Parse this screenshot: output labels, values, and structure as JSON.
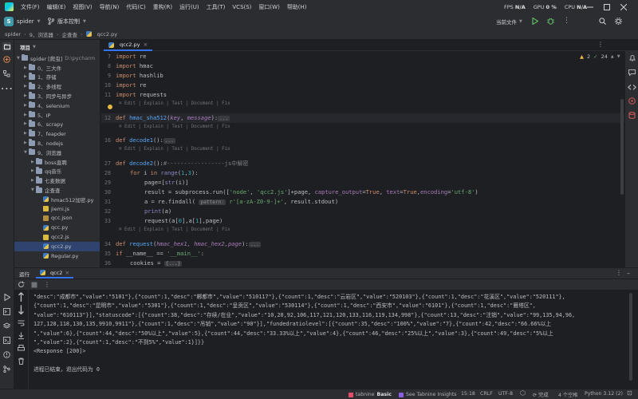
{
  "menu": [
    "文件(F)",
    "编辑(E)",
    "视图(V)",
    "导航(N)",
    "代码(C)",
    "重构(R)",
    "运行(U)",
    "工具(T)",
    "VCS(S)",
    "窗口(W)",
    "帮助(H)"
  ],
  "metrics": {
    "fps_label": "FPS",
    "fps_value": "N/A",
    "gpu_label": "GPU",
    "gpu_value": "0 %",
    "cpu_label": "CPU",
    "cpu_value": "N/A"
  },
  "toolbar": {
    "project_initial": "S",
    "project_name": "spider",
    "vcs_label": "版本控制",
    "run_config": "当前文件"
  },
  "breadcrumbs": [
    "spider",
    "9、浏览器",
    "企查查",
    "qcc2.py"
  ],
  "project_panel": {
    "title": "项目"
  },
  "tree": [
    {
      "indent": 0,
      "open": true,
      "type": "dir",
      "label": "spider [爬虫]",
      "hint": "D:\\pycharm"
    },
    {
      "indent": 1,
      "open": false,
      "type": "dir",
      "label": "0、三大件",
      "hint": ""
    },
    {
      "indent": 1,
      "open": false,
      "type": "dir",
      "label": "1、存储",
      "hint": ""
    },
    {
      "indent": 1,
      "open": false,
      "type": "dir",
      "label": "2、多线程",
      "hint": ""
    },
    {
      "indent": 1,
      "open": false,
      "type": "dir",
      "label": "3、同步与异步",
      "hint": ""
    },
    {
      "indent": 1,
      "open": false,
      "type": "dir",
      "label": "4、selenium",
      "hint": ""
    },
    {
      "indent": 1,
      "open": false,
      "type": "dir",
      "label": "5、IP",
      "hint": ""
    },
    {
      "indent": 1,
      "open": false,
      "type": "dir",
      "label": "6、scrapy",
      "hint": ""
    },
    {
      "indent": 1,
      "open": false,
      "type": "dir",
      "label": "7、feapder",
      "hint": ""
    },
    {
      "indent": 1,
      "open": false,
      "type": "dir",
      "label": "8、nodejs",
      "hint": ""
    },
    {
      "indent": 1,
      "open": true,
      "type": "dir",
      "label": "9、浏览器",
      "hint": ""
    },
    {
      "indent": 2,
      "open": false,
      "type": "dir",
      "label": "boss直聘",
      "hint": ""
    },
    {
      "indent": 2,
      "open": false,
      "type": "dir",
      "label": "qq音乐",
      "hint": ""
    },
    {
      "indent": 2,
      "open": false,
      "type": "dir",
      "label": "七麦数据",
      "hint": ""
    },
    {
      "indent": 2,
      "open": true,
      "type": "dir",
      "label": "企查查",
      "hint": ""
    },
    {
      "indent": 3,
      "open": null,
      "type": "py",
      "label": "hmac512加密.py",
      "hint": ""
    },
    {
      "indent": 3,
      "open": null,
      "type": "js",
      "label": "jiemi.js",
      "hint": ""
    },
    {
      "indent": 3,
      "open": null,
      "type": "json",
      "label": "qcc.json",
      "hint": ""
    },
    {
      "indent": 3,
      "open": null,
      "type": "py",
      "label": "qcc.py",
      "hint": ""
    },
    {
      "indent": 3,
      "open": null,
      "type": "js",
      "label": "qcc2.js",
      "hint": ""
    },
    {
      "indent": 3,
      "open": null,
      "type": "py",
      "label": "qcc2.py",
      "hint": "",
      "selected": true
    },
    {
      "indent": 3,
      "open": null,
      "type": "py",
      "label": "Regular.py",
      "hint": ""
    }
  ],
  "editor": {
    "tab_label": "qcc2.py",
    "inspection": {
      "warnings": "2",
      "weak": "24"
    },
    "codelens": "Edit | Explain | Test | Document | Fix",
    "lines": {
      "l7": "7",
      "l8": "8",
      "l9": "9",
      "l10": "10",
      "l11": "11",
      "l12": "12",
      "l16": "16",
      "l27": "27",
      "l28": "28",
      "l29": "29",
      "l30": "30",
      "l31": "31",
      "l32": "32",
      "l33": "33",
      "l34": "34",
      "l35": "35",
      "l36": "36"
    },
    "code": {
      "c7_kw": "import",
      "c7_mod": " re",
      "c8_kw": "import",
      "c8_mod": " hmac",
      "c9_kw": "import",
      "c9_mod": " hashlib",
      "c10_kw": "import",
      "c10_mod": " re",
      "c11_kw": "import",
      "c11_mod": " requests",
      "c12_kw": "def ",
      "c12_fn": "hmac_sha512",
      "c12_p1": "(",
      "c12_a1": "key",
      "c12_p2": ", ",
      "c12_a2": "message",
      "c12_p3": "):",
      "c12_fold": "...",
      "c16_kw": "def ",
      "c16_fn": "decode1",
      "c16_rest": "():",
      "c16_fold": "...",
      "c27_kw": "def ",
      "c27_fn": "decode2",
      "c27_rest": "():",
      "c27_cmt": "#-----------------js中解密",
      "c28_kw": "for",
      "c28_a": " i ",
      "c28_kw2": "in",
      "c28_b": " ",
      "c28_bi": "range",
      "c28_c": "(",
      "c28_n1": "1",
      "c28_d": ",",
      "c28_n2": "3",
      "c28_e": "):",
      "c29_a": "page=[",
      "c29_bi": "str",
      "c29_b": "(i)]",
      "c30_a": "result = subprocess.run([",
      "c30_s1": "'node'",
      "c30_b": ", ",
      "c30_s2": "'qcc2.js'",
      "c30_c": "]+page, ",
      "c30_n1": "capture_output",
      "c30_d": "=",
      "c30_k1": "True",
      "c30_e": ", ",
      "c30_n2": "text",
      "c30_f": "=",
      "c30_k2": "True",
      "c30_g": ",",
      "c30_n3": "encoding",
      "c30_h": "=",
      "c30_s3": "'utf-8'",
      "c30_i": ")",
      "c31_a": "a = re.findall( ",
      "c31_inlay": "pattern:",
      "c31_b": " ",
      "c31_s": "r'[a-zA-Z0-9-]+'",
      "c31_c": ", result.stdout)",
      "c32_bi": "print",
      "c32_a": "(a)",
      "c33_a": "request(a[",
      "c33_n1": "0",
      "c33_b": "],a[",
      "c33_n2": "1",
      "c33_c": "],page)",
      "c34_kw": "def ",
      "c34_fn": "request",
      "c34_a": "(",
      "c34_p": "hmac_hex1, hmac_hex2,page",
      "c34_b": "):",
      "c34_fold": "...",
      "c35_kw": "if",
      "c35_a": " __name__ == ",
      "c35_s": "'__main__'",
      "c35_b": ":",
      "c36_a": "cookies = ",
      "c36_fold": "{...}"
    }
  },
  "run_panel": {
    "title": "运行",
    "tab_label": "qcc2"
  },
  "console": [
    "\"desc\":\"成都市\",\"value\":\"5101\"},{\"count\":1,\"desc\":\"郴都市\",\"value\":\"510117\"},{\"count\":1,\"desc\":\"云岩区\",\"value\":\"520103\"},{\"count\":1,\"desc\":\"花溪区\",\"value\":\"520111\"},",
    "{\"count\":1,\"desc\":\"昆明市\",\"value\":\"5301\"},{\"count\":1,\"desc\":\"呈贡区\",\"value\":\"530114\"},{\"count\":1,\"desc\":\"西安市\",\"value\":\"6101\"},{\"count\":1,\"desc\":\"雁塔区\",",
    "\"value\":\"610113\"}],\"statuscode\":[{\"count\":38,\"desc\":\"存续/在业\",\"value\":\"10,20,92,106,117,121,120,133,116,119,134,998\"},{\"count\":13,\"desc\":\"注销\",\"value\":\"99,135,94,96,",
    "127,128,118,130,135,9910,9911\"},{\"count\":1,\"desc\":\"吊销\",\"value\":\"90\"}],\"fundedratiolevel\":[{\"count\":35,\"desc\":\"100%\",\"value\":\"7},{\"count\":42,\"desc\":\"66.66%以上",
    "\",\"value\":6},{\"count\":44,\"desc\":\"50%以上\",\"value\":5},{\"count\":44,\"desc\":\"33.33%以上\",\"value\":4},{\"count\":46,\"desc\":\"25%以上\",\"value\":3},{\"count\":49,\"desc\":\"5%以上",
    "\",\"value\":2},{\"count\":1,\"desc\":\"不到5%\",\"value\":1}]}}",
    "<Response [200]>",
    "",
    "进程已结束，退出代码为 0"
  ],
  "status": {
    "tabnine": "tabnine",
    "tabnine_plan": "Basic",
    "insights": "See Tabnine Insights",
    "position": "15:18",
    "line_sep": "CRLF",
    "encoding": "UTF-8",
    "indent": "4 个空格",
    "interpreter": "Python 3.12 (2)",
    "ide": "完成"
  },
  "colors": {
    "accent": "#3574f0",
    "keyword": "#cf8e6d",
    "function": "#56a8f5",
    "string": "#6aab73",
    "number": "#2aacb8",
    "selection": "#2e436e"
  }
}
